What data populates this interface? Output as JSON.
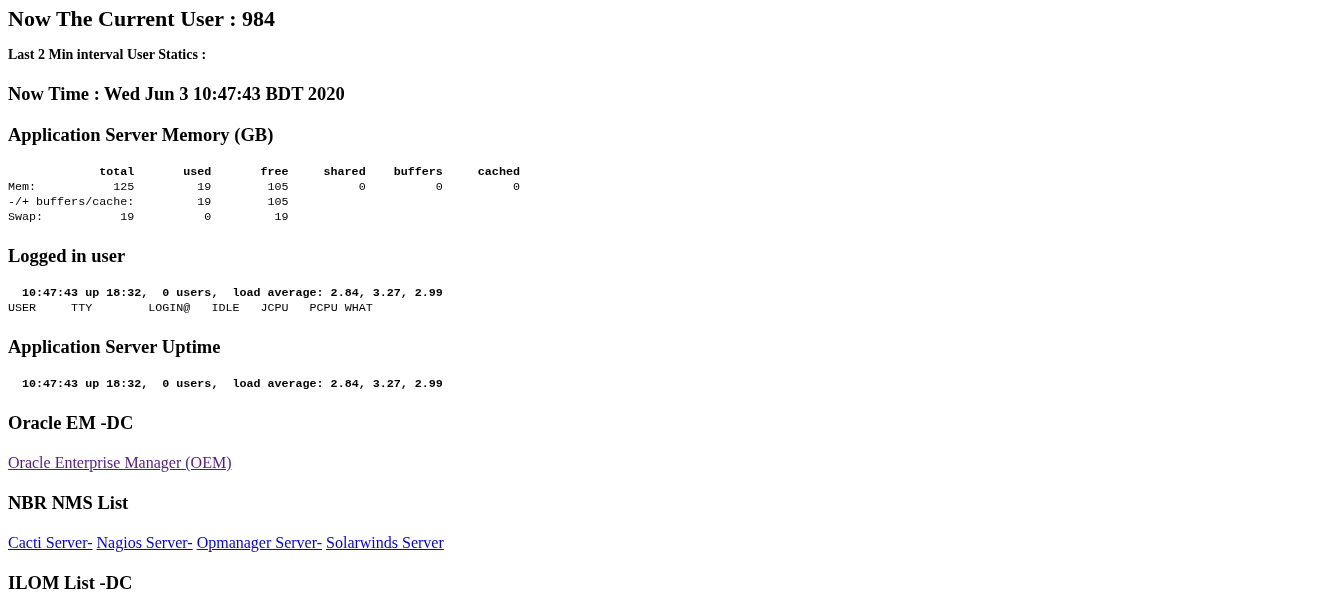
{
  "title": "Now The Current User : 984",
  "subtitle": "Last 2 Min interval User Statics :",
  "now_time": "Now Time : Wed Jun 3 10:47:43 BDT 2020",
  "memory": {
    "title": "Application Server Memory (GB)",
    "columns": [
      "total",
      "used",
      "free",
      "shared",
      "buffers",
      "cached"
    ],
    "rows": [
      {
        "label": "Mem:",
        "kind": "full",
        "values": [
          "125",
          "19",
          "105",
          "0",
          "0",
          "0"
        ]
      },
      {
        "label": "-/+ buffers/cache:",
        "kind": "no_total",
        "values": [
          "19",
          "105"
        ]
      },
      {
        "label": "Swap:",
        "kind": "full",
        "values": [
          "19",
          "0",
          "19"
        ]
      }
    ]
  },
  "logged_in": {
    "title": "Logged in user",
    "lines": [
      {
        "kind": "summary",
        "text": "10:47:43 up 18:32,  0 users,  load average: 2.84, 3.27, 2.99"
      },
      {
        "kind": "header",
        "text": "USER     TTY        LOGIN@   IDLE   JCPU   PCPU WHAT"
      }
    ]
  },
  "uptime": {
    "title": "Application Server Uptime",
    "lines": [
      {
        "kind": "summary",
        "text": "10:47:43 up 18:32,  0 users,  load average: 2.84, 3.27, 2.99"
      }
    ]
  },
  "oracle": {
    "title": "Oracle EM -DC",
    "links": [
      {
        "label": "Oracle Enterprise Manager (OEM)",
        "visited": true
      }
    ]
  },
  "nms": {
    "title": "NBR NMS List",
    "links": [
      {
        "label": "Cacti Server-",
        "visited": false
      },
      {
        "label": "Nagios Server-",
        "visited": false
      },
      {
        "label": "Opmanager Server-",
        "visited": false
      },
      {
        "label": "Solarwinds Server",
        "visited": false
      }
    ]
  },
  "ilom": {
    "title": "ILOM List -DC"
  }
}
